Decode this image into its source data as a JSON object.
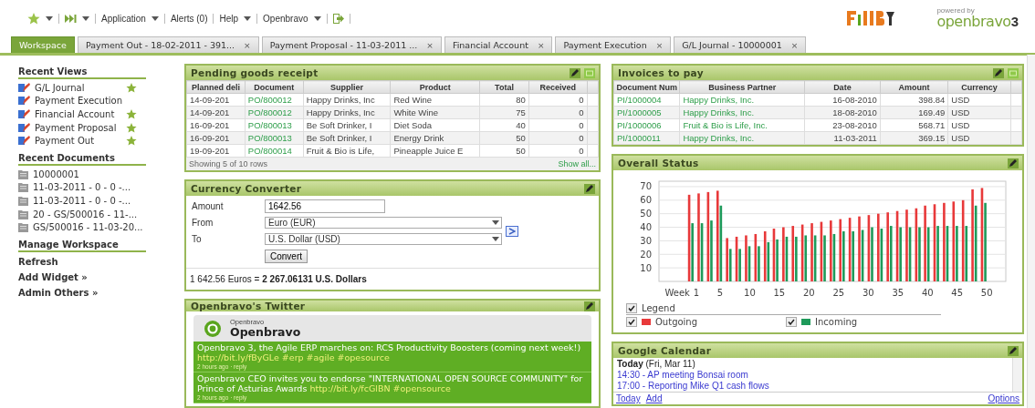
{
  "top_bar": {
    "items": [
      {
        "kind": "favorites",
        "dropdown": true
      },
      {
        "kind": "recent",
        "dropdown": true
      },
      {
        "kind": "menu",
        "label": "Application",
        "dropdown": true
      },
      {
        "kind": "menu",
        "label": "Alerts (0)",
        "dropdown": false
      },
      {
        "kind": "menu",
        "label": "Help",
        "dropdown": true
      },
      {
        "kind": "menu",
        "label": "Openbravo",
        "dropdown": true
      },
      {
        "kind": "logout",
        "dropdown": false
      }
    ],
    "branding": {
      "powered_by": "powered by",
      "name": "openbravo",
      "version": "3"
    }
  },
  "tabs": [
    {
      "label": "Workspace",
      "selected": true
    },
    {
      "label": "Payment Out - 18-02-2011 - 391...",
      "selected": false,
      "close": "×"
    },
    {
      "label": "Payment Proposal - 11-03-2011 ...",
      "selected": false,
      "close": "×"
    },
    {
      "label": "Financial Account",
      "selected": false,
      "close": "×"
    },
    {
      "label": "Payment Execution",
      "selected": false,
      "close": "×"
    },
    {
      "label": "G/L Journal - 10000001",
      "selected": false,
      "close": "×"
    }
  ],
  "sidebar": {
    "sections": [
      {
        "title": "Recent Views",
        "kind": "views",
        "items": [
          {
            "label": "G/L Journal",
            "starred": true
          },
          {
            "label": "Payment Execution",
            "starred": false
          },
          {
            "label": "Financial Account",
            "starred": true
          },
          {
            "label": "Payment Proposal",
            "starred": true
          },
          {
            "label": "Payment Out",
            "starred": true
          }
        ]
      },
      {
        "title": "Recent Documents",
        "kind": "documents",
        "items": [
          {
            "label": "10000001"
          },
          {
            "label": "11-03-2011 - 0 - 0 -..."
          },
          {
            "label": "11-03-2011 - 0 - 0 -..."
          },
          {
            "label": "20 - GS/500016 - 11-..."
          },
          {
            "label": "GS/500016 - 11-03-20..."
          }
        ]
      },
      {
        "title": "Manage Workspace",
        "kind": "actions",
        "items": [
          {
            "label": "Refresh"
          },
          {
            "label": "Add Widget »"
          },
          {
            "label": "Admin Others »"
          }
        ]
      }
    ]
  },
  "pending_goods_receipt": {
    "title": "Pending goods receipt",
    "maximizable": true,
    "columns": [
      "Planned deli",
      "Document",
      "Supplier",
      "Product",
      "Total",
      "Received"
    ],
    "rows": [
      [
        "14-09-201",
        "PO/800012",
        "Happy Drinks, Inc",
        "Red Wine",
        "80",
        "0"
      ],
      [
        "14-09-201",
        "PO/800012",
        "Happy Drinks, Inc",
        "White Wine",
        "75",
        "0"
      ],
      [
        "16-09-201",
        "PO/800013",
        "Be Soft Drinker, I",
        "Diet Soda",
        "40",
        "0"
      ],
      [
        "16-09-201",
        "PO/800013",
        "Be Soft Drinker, I",
        "Energy Drink",
        "50",
        "0"
      ],
      [
        "19-09-201",
        "PO/800014",
        "Fruit & Bio is Life,",
        "Pineapple Juice E",
        "50",
        "0"
      ]
    ],
    "footer": "Showing 5 of 10 rows",
    "show_all": "Show all..."
  },
  "currency_converter": {
    "title": "Currency Converter",
    "maximizable": false,
    "amount_label": "Amount",
    "amount": "1642.56",
    "from_label": "From",
    "from": "Euro (EUR)",
    "to_label": "To",
    "to": "U.S. Dollar (USD)",
    "convert": "Convert",
    "result": "1 642.56 Euros = **2 267.06131 U.S. Dollars**"
  },
  "twitter": {
    "title": "Openbravo's Twitter",
    "maximizable": false,
    "account_small": "Openbravo",
    "account": "Openbravo",
    "tweets": [
      {
        "text": "Openbravo 3, the Agile ERP marches on: RCS Productivity Boosters (coming next week!)",
        "link": "http://bit.ly/fByGLe",
        "tags": "#erp #agile #opesource",
        "meta": "2 hours ago · reply"
      },
      {
        "text": "Openbravo CEO invites you to endorse \"INTERNATIONAL OPEN SOURCE COMMUNITY\" for Prince of Asturias Awards",
        "link": "http://bit.ly/fcGlBN",
        "tags": "#opensource",
        "meta": "2 hours ago · reply"
      }
    ]
  },
  "invoices_to_pay": {
    "title": "Invoices to pay",
    "maximizable": true,
    "columns": [
      "Document Num",
      "Business Partner",
      "Date",
      "Amount",
      "Currency"
    ],
    "rows": [
      [
        "PI/1000004",
        "Happy Drinks, Inc.",
        "16-08-2010",
        "398.84",
        "USD"
      ],
      [
        "PI/1000005",
        "Happy Drinks, Inc.",
        "18-08-2010",
        "169.49",
        "USD"
      ],
      [
        "PI/1000006",
        "Fruit & Bio is Life, Inc.",
        "23-08-2010",
        "568.71",
        "USD"
      ],
      [
        "PI/1000011",
        "Happy Drinks, Inc.",
        "11-03-2011",
        "369.15",
        "USD"
      ]
    ]
  },
  "overall_status": {
    "title": "Overall Status",
    "maximizable": false,
    "chart_data": {
      "type": "bar",
      "grid": true,
      "stacked": false,
      "xlabel": "Week",
      "x": [
        0.1,
        1.7,
        3.3,
        4.9,
        6.5,
        8.1,
        9.7,
        11.3,
        12.9,
        14.4,
        16.0,
        17.6,
        19.2,
        20.8,
        22.4,
        24.0,
        25.6,
        27.2,
        28.8,
        30.4,
        32.0,
        33.6,
        35.2,
        36.8,
        38.4,
        39.9,
        41.5,
        43.1,
        44.7,
        46.3,
        47.9,
        49.5
      ],
      "series": [
        {
          "name": "Outgoing",
          "color": "#e8393a",
          "values": [
            64,
            65,
            66,
            67,
            32,
            33,
            34,
            35,
            37,
            39,
            40,
            41,
            42,
            43,
            44,
            45,
            46,
            47,
            48,
            49,
            50,
            51,
            52,
            53,
            54,
            56,
            57,
            58,
            59,
            60,
            68,
            69
          ]
        },
        {
          "name": "Incoming",
          "color": "#1e9a5a",
          "values": [
            43,
            43,
            45,
            56,
            24,
            24,
            26,
            26,
            29,
            31,
            33,
            33,
            34,
            34,
            34,
            35,
            37,
            37,
            38,
            40,
            39,
            41,
            40,
            40,
            40,
            40,
            41,
            41,
            41,
            41,
            56,
            58
          ]
        }
      ],
      "xlim": [
        -5.3,
        53.2
      ],
      "ylim": [
        0,
        74
      ],
      "xticks": [
        1,
        5,
        10,
        15,
        20,
        25,
        30,
        35,
        40,
        45,
        50
      ],
      "yticks": [
        10,
        20,
        30,
        40,
        50,
        60,
        70
      ]
    },
    "legend": {
      "label": "Legend",
      "checked": true
    },
    "series_checked": [
      true,
      true
    ]
  },
  "google_calendar": {
    "title": "Google Calendar",
    "maximizable": false,
    "day": "**Today** (Fri, Mar 11)",
    "events": [
      "14:30 - AP meeting Bonsai room",
      "17:00 - Reporting Mike Q1 cash flows"
    ],
    "links": [
      "Today",
      "Add"
    ],
    "options": "Options"
  }
}
